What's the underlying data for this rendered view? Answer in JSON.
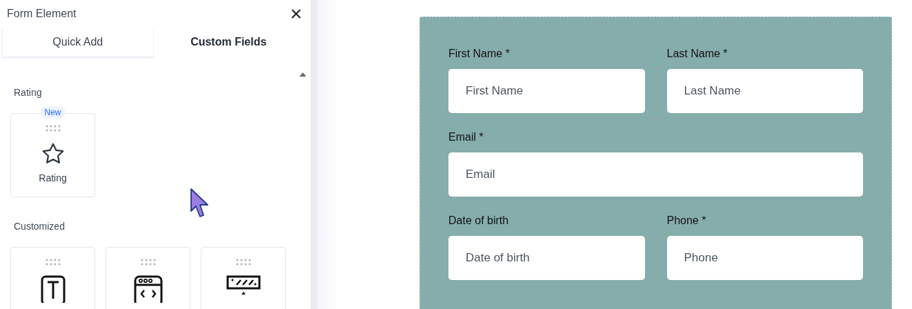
{
  "panel": {
    "title": "Form Element",
    "close": "×"
  },
  "tabs": [
    {
      "label": "Quick Add",
      "selected": false
    },
    {
      "label": "Custom Fields",
      "selected": true
    }
  ],
  "sections": [
    {
      "title": "Rating",
      "items": [
        {
          "kind": "star",
          "label": "Rating",
          "badge": "New"
        }
      ]
    },
    {
      "title": "Customized",
      "items": [
        {
          "kind": "text"
        },
        {
          "kind": "code"
        },
        {
          "kind": "banner"
        }
      ]
    }
  ],
  "form": {
    "rows": [
      [
        {
          "label": "First Name *",
          "placeholder": "First Name"
        },
        {
          "label": "Last Name *",
          "placeholder": "Last Name"
        }
      ],
      [
        {
          "label": "Email *",
          "placeholder": "Email"
        }
      ],
      [
        {
          "label": "Date of birth",
          "placeholder": "Date of birth"
        },
        {
          "label": "Phone *",
          "placeholder": "Phone"
        }
      ]
    ]
  }
}
